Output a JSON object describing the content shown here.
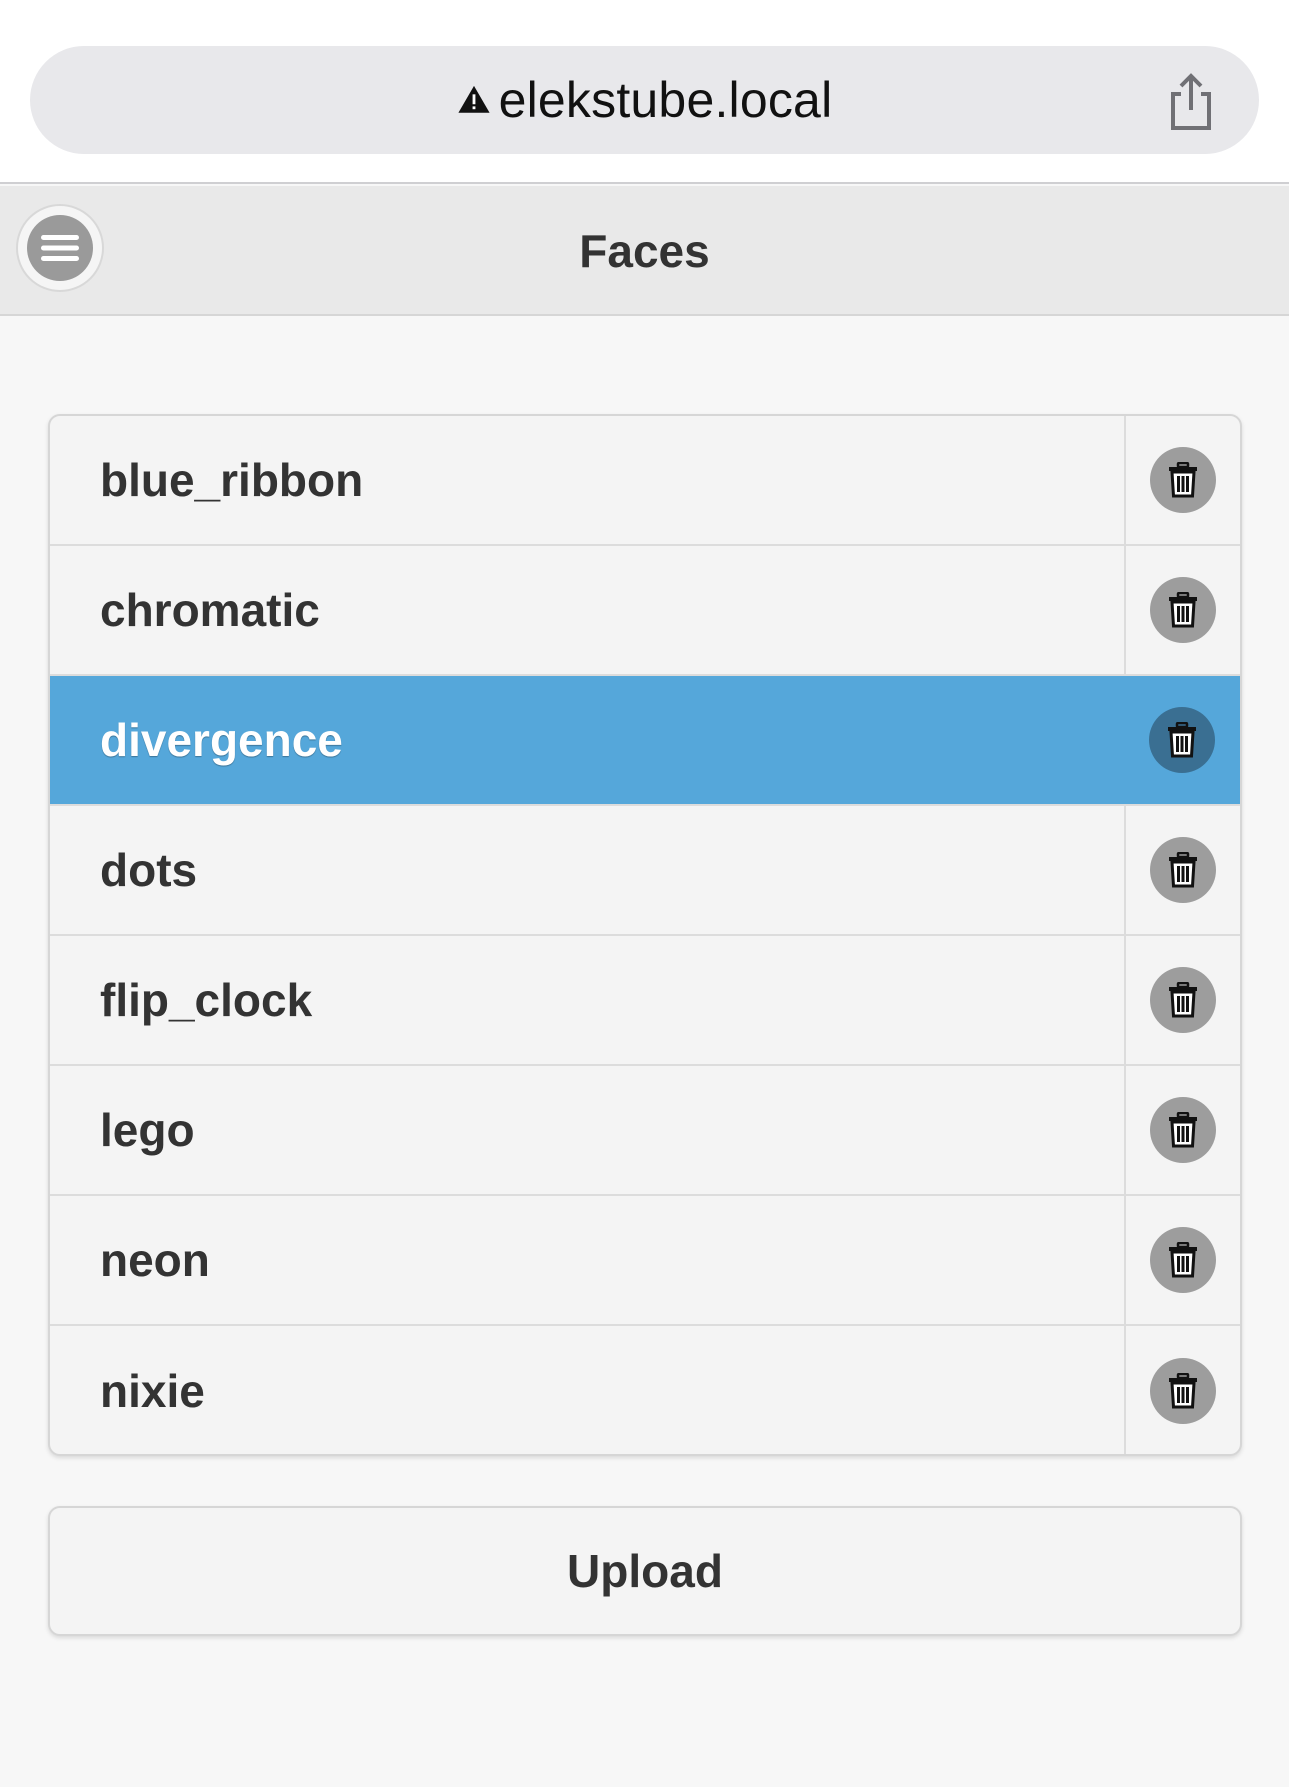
{
  "browser": {
    "url": "elekstube.local",
    "warning_icon": "warning-triangle-icon",
    "share_icon": "share-icon"
  },
  "header": {
    "title": "Faces",
    "menu_icon": "hamburger-menu-icon"
  },
  "faces": [
    {
      "name": "blue_ribbon",
      "selected": false
    },
    {
      "name": "chromatic",
      "selected": false
    },
    {
      "name": "divergence",
      "selected": true
    },
    {
      "name": "dots",
      "selected": false
    },
    {
      "name": "flip_clock",
      "selected": false
    },
    {
      "name": "lego",
      "selected": false
    },
    {
      "name": "neon",
      "selected": false
    },
    {
      "name": "nixie",
      "selected": false
    }
  ],
  "actions": {
    "upload_label": "Upload"
  },
  "colors": {
    "selected_row": "#55a7da",
    "delete_button": "#9d9d9d",
    "delete_button_selected": "#3a6f92"
  }
}
